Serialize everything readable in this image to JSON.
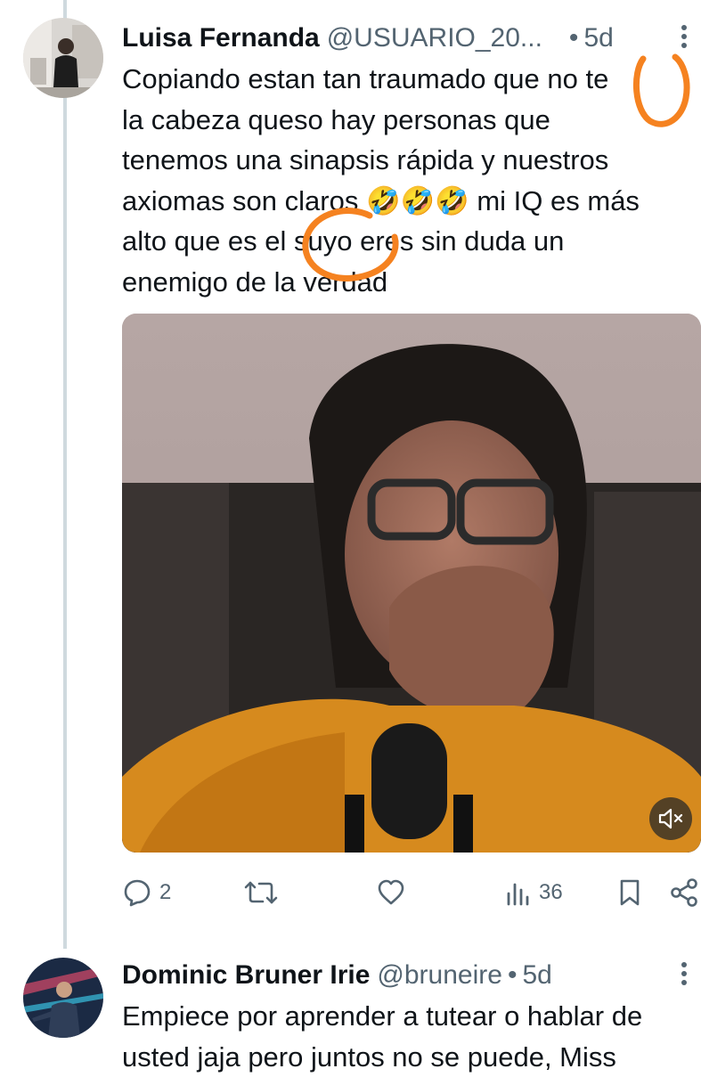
{
  "tweets": [
    {
      "name": "Luisa Fernanda",
      "handle": "@USUARIO_20...",
      "separator": "•",
      "time": "5d",
      "text": "Copiando estan tan traumado que no te la cabeza queso hay personas que tenemos una sinapsis rápida y nuestros axiomas son claros 🤣🤣🤣 mi IQ es más alto que es el suyo eres sin duda un enemigo de la verdad",
      "text_lines": [
        "Copiando estan tan traumado que no te",
        "la cabeza queso hay personas que",
        "tenemos una sinapsis rápida y nuestros",
        "axiomas son claros 🤣🤣🤣 mi IQ es más",
        "alto que es el suyo eres sin duda un",
        "enemigo de la verdad"
      ],
      "stats": {
        "replies": "2",
        "retweets": "",
        "likes": "",
        "views": "36"
      }
    },
    {
      "name": "Dominic Bruner Irie",
      "handle": "@bruneire",
      "separator": "•",
      "time": "5d",
      "text_lines": [
        "Empiece por aprender a tutear o hablar de",
        "usted jaja pero juntos no se puede, Miss"
      ]
    }
  ],
  "icons": {
    "more": "more-options-icon",
    "reply": "reply-icon",
    "retweet": "retweet-icon",
    "like": "like-icon",
    "views": "views-icon",
    "bookmark": "bookmark-icon",
    "share": "share-icon",
    "mute": "volume-muted-icon"
  },
  "colors": {
    "text": "#0f1419",
    "secondary": "#536471",
    "thread_line": "#cfd9de",
    "annotation": "#f58220"
  }
}
